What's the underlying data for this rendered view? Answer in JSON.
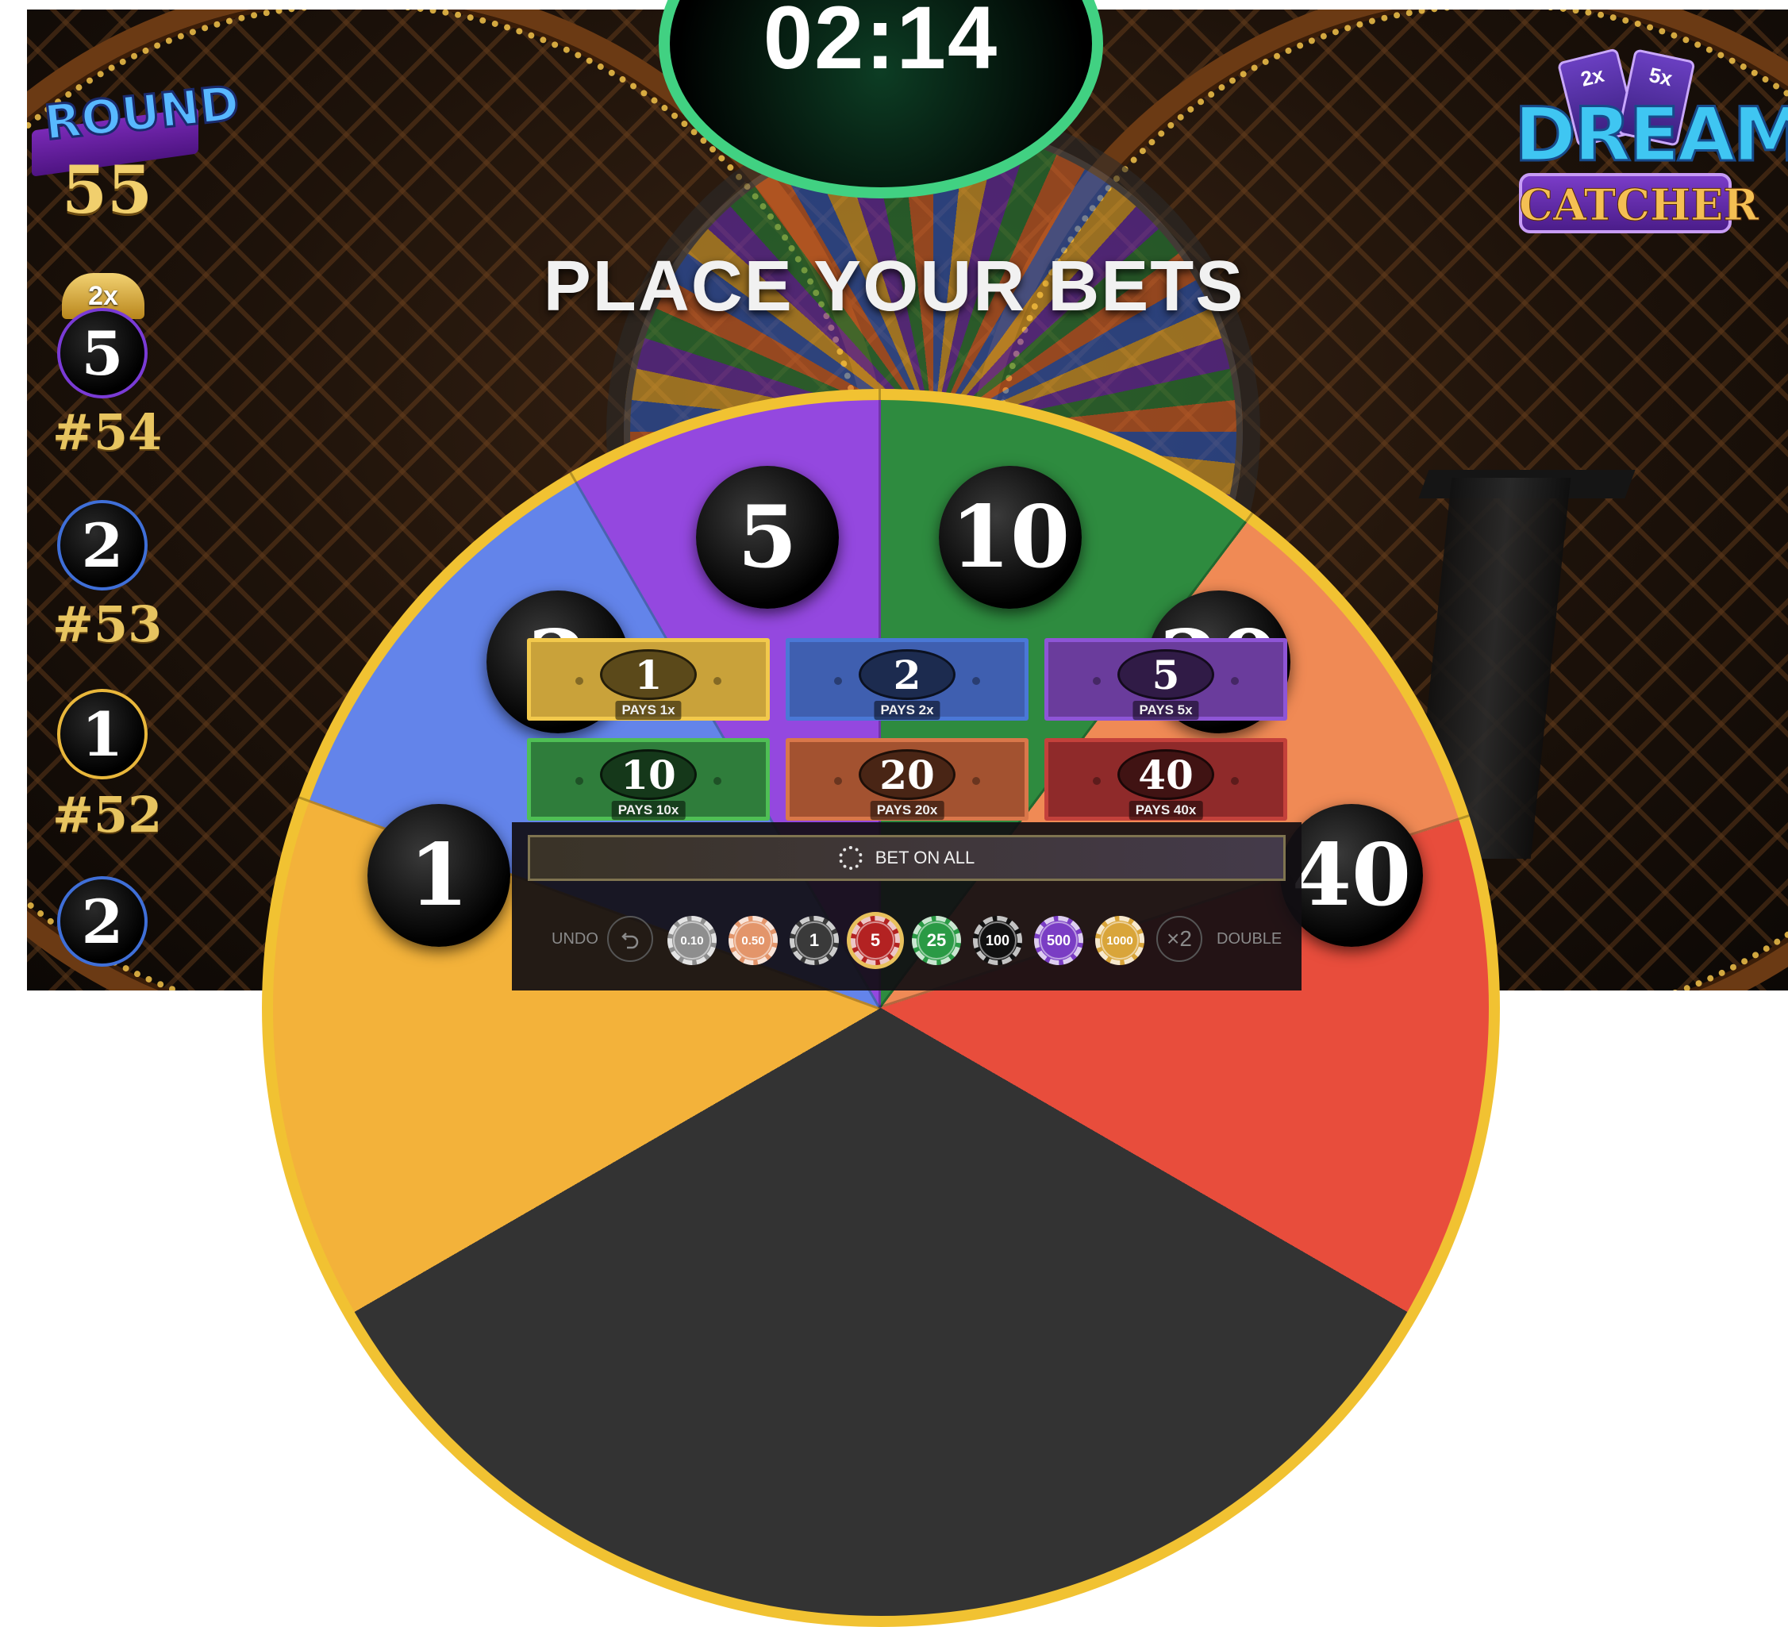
{
  "timer": {
    "value": "02:14"
  },
  "headline": "PLACE YOUR BETS",
  "round": {
    "title": "ROUND",
    "number": "55"
  },
  "history": [
    {
      "value": "5",
      "multiplier": "2x",
      "round_id": "#54",
      "ring_color": "#7a3bd6"
    },
    {
      "value": "2",
      "round_id": "#53",
      "ring_color": "#3f6fd8"
    },
    {
      "value": "1",
      "round_id": "#52",
      "ring_color": "#e9b73b"
    },
    {
      "value": "2",
      "round_id": "",
      "ring_color": "#3f6fd8"
    }
  ],
  "logo": {
    "card_left": "2x",
    "card_right": "5x",
    "word1": "DREAM",
    "word2": "CATCHER"
  },
  "wheel_segments": [
    {
      "label": "5",
      "color": "#9448df"
    },
    {
      "label": "10",
      "color": "#2e8b3f"
    },
    {
      "label": "2",
      "color": "#6384ea"
    },
    {
      "label": "20",
      "color": "#f08a55"
    },
    {
      "label": "1",
      "color": "#f3b23a"
    },
    {
      "label": "40",
      "color": "#e84d3c"
    }
  ],
  "bets": [
    {
      "number": "1",
      "pays": "PAYS 1x",
      "color": "#c9a23a",
      "border": "#f2c94c"
    },
    {
      "number": "2",
      "pays": "PAYS 2x",
      "color": "#3f5fb0",
      "border": "#4a78d6"
    },
    {
      "number": "5",
      "pays": "PAYS 5x",
      "color": "#6a3c9c",
      "border": "#8e55d6"
    },
    {
      "number": "10",
      "pays": "PAYS 10x",
      "color": "#2f7d3b",
      "border": "#4fbf55"
    },
    {
      "number": "20",
      "pays": "PAYS 20x",
      "color": "#a35230",
      "border": "#d9774a"
    },
    {
      "number": "40",
      "pays": "PAYS 40x",
      "color": "#8f2a2a",
      "border": "#c4413b"
    }
  ],
  "controls": {
    "bet_all": "BET ON ALL",
    "undo": "UNDO",
    "undo_icon": "undo-arrow-icon",
    "double": "DOUBLE",
    "double_icon": "×2"
  },
  "chips": [
    {
      "value": "0.10",
      "color": "#8e8e8e",
      "selected": false
    },
    {
      "value": "0.50",
      "color": "#e3956a",
      "selected": false
    },
    {
      "value": "1",
      "color": "#3a3a3a",
      "selected": false
    },
    {
      "value": "5",
      "color": "#b32222",
      "selected": true
    },
    {
      "value": "25",
      "color": "#2a9a45",
      "selected": false
    },
    {
      "value": "100",
      "color": "#111111",
      "selected": false
    },
    {
      "value": "500",
      "color": "#7a3dc4",
      "selected": false
    },
    {
      "value": "1000",
      "color": "#d9a53a",
      "selected": false
    }
  ]
}
